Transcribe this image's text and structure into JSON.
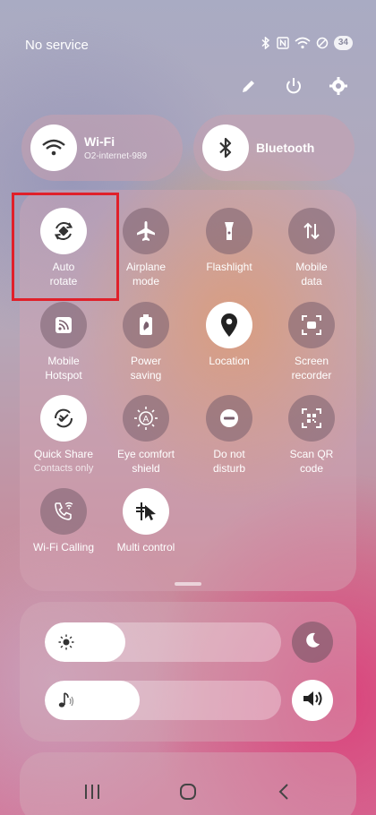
{
  "status": {
    "carrier": "No service",
    "battery": "34",
    "icons": [
      "bluetooth-icon",
      "nfc-icon",
      "wifi-icon",
      "do-not-disturb-icon"
    ]
  },
  "top_actions": [
    "edit-icon",
    "power-icon",
    "settings-icon"
  ],
  "wifi": {
    "label": "Wi-Fi",
    "network": "O2-internet-989"
  },
  "bluetooth": {
    "label": "Bluetooth"
  },
  "tiles": [
    {
      "label1": "Auto",
      "label2": "rotate",
      "icon": "auto-rotate-icon",
      "on": true
    },
    {
      "label1": "Airplane",
      "label2": "mode",
      "icon": "airplane-icon",
      "on": false
    },
    {
      "label1": "Flashlight",
      "label2": "",
      "icon": "flashlight-icon",
      "on": false
    },
    {
      "label1": "Mobile",
      "label2": "data",
      "icon": "mobile-data-icon",
      "on": false
    },
    {
      "label1": "Mobile",
      "label2": "Hotspot",
      "icon": "hotspot-icon",
      "on": false
    },
    {
      "label1": "Power",
      "label2": "saving",
      "icon": "power-saving-icon",
      "on": false
    },
    {
      "label1": "Location",
      "label2": "",
      "icon": "location-icon",
      "on": true
    },
    {
      "label1": "Screen",
      "label2": "recorder",
      "icon": "screen-recorder-icon",
      "on": false
    },
    {
      "label1": "Quick Share",
      "label2": "",
      "sub": "Contacts only",
      "icon": "quick-share-icon",
      "on": true
    },
    {
      "label1": "Eye comfort",
      "label2": "shield",
      "icon": "eye-comfort-icon",
      "on": false
    },
    {
      "label1": "Do not",
      "label2": "disturb",
      "icon": "dnd-icon",
      "on": false
    },
    {
      "label1": "Scan QR",
      "label2": "code",
      "icon": "qr-icon",
      "on": false
    },
    {
      "label1": "Wi-Fi Calling",
      "label2": "",
      "icon": "wifi-calling-icon",
      "on": false
    },
    {
      "label1": "Multi control",
      "label2": "",
      "icon": "multi-control-icon",
      "on": true
    }
  ],
  "brightness": {
    "level": 0.34,
    "icon": "sun-icon",
    "side_icon": "moon-icon"
  },
  "volume": {
    "level": 0.4,
    "icon": "music-note-icon",
    "side_icon": "speaker-icon"
  },
  "nav": [
    "recents-icon",
    "home-icon",
    "back-icon"
  ],
  "colors": {
    "highlight": "#e0202a",
    "tile_off": "#7a5f6e",
    "tile_on": "#ffffff"
  }
}
